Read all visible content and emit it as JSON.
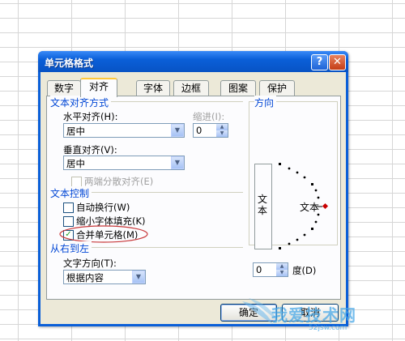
{
  "dialog": {
    "title": "单元格格式",
    "help_glyph": "?",
    "close_glyph": "✕"
  },
  "tabs": [
    {
      "label": "数字"
    },
    {
      "label": "对齐",
      "active": true
    },
    {
      "label": "字体"
    },
    {
      "label": "边框"
    },
    {
      "label": "图案"
    },
    {
      "label": "保护"
    }
  ],
  "alignment": {
    "group_title": "文本对齐方式",
    "horizontal_label": "水平对齐(H):",
    "horizontal_value": "居中",
    "vertical_label": "垂直对齐(V):",
    "vertical_value": "居中",
    "indent_label": "缩进(I):",
    "indent_value": "0",
    "distributed_label": "两端分散对齐(E)"
  },
  "text_control": {
    "group_title": "文本控制",
    "wrap_label": "自动换行(W)",
    "shrink_label": "缩小字体填充(K)",
    "merge_label": "合并单元格(M)",
    "check_glyph": "✓"
  },
  "rtl": {
    "group_title": "从右到左",
    "direction_label": "文字方向(T):",
    "direction_value": "根据内容"
  },
  "orientation": {
    "group_title": "方向",
    "vertical_text": "文本",
    "dial_text": "文本",
    "degree_value": "0",
    "degree_label": "度(D)"
  },
  "buttons": {
    "ok": "确定",
    "cancel": "取消"
  },
  "watermark": {
    "text": "我爱技术网",
    "url": "52jsw.com"
  },
  "colors": {
    "title_bar": "#0a5fd8",
    "group_title": "#0046d5",
    "dialog_bg": "#ece9d8",
    "highlight_ellipse": "#c8383a",
    "dial_marker": "#c80000"
  },
  "icons": {
    "combo_arrow": "▼",
    "spin_up": "▲",
    "spin_down": "▼"
  }
}
